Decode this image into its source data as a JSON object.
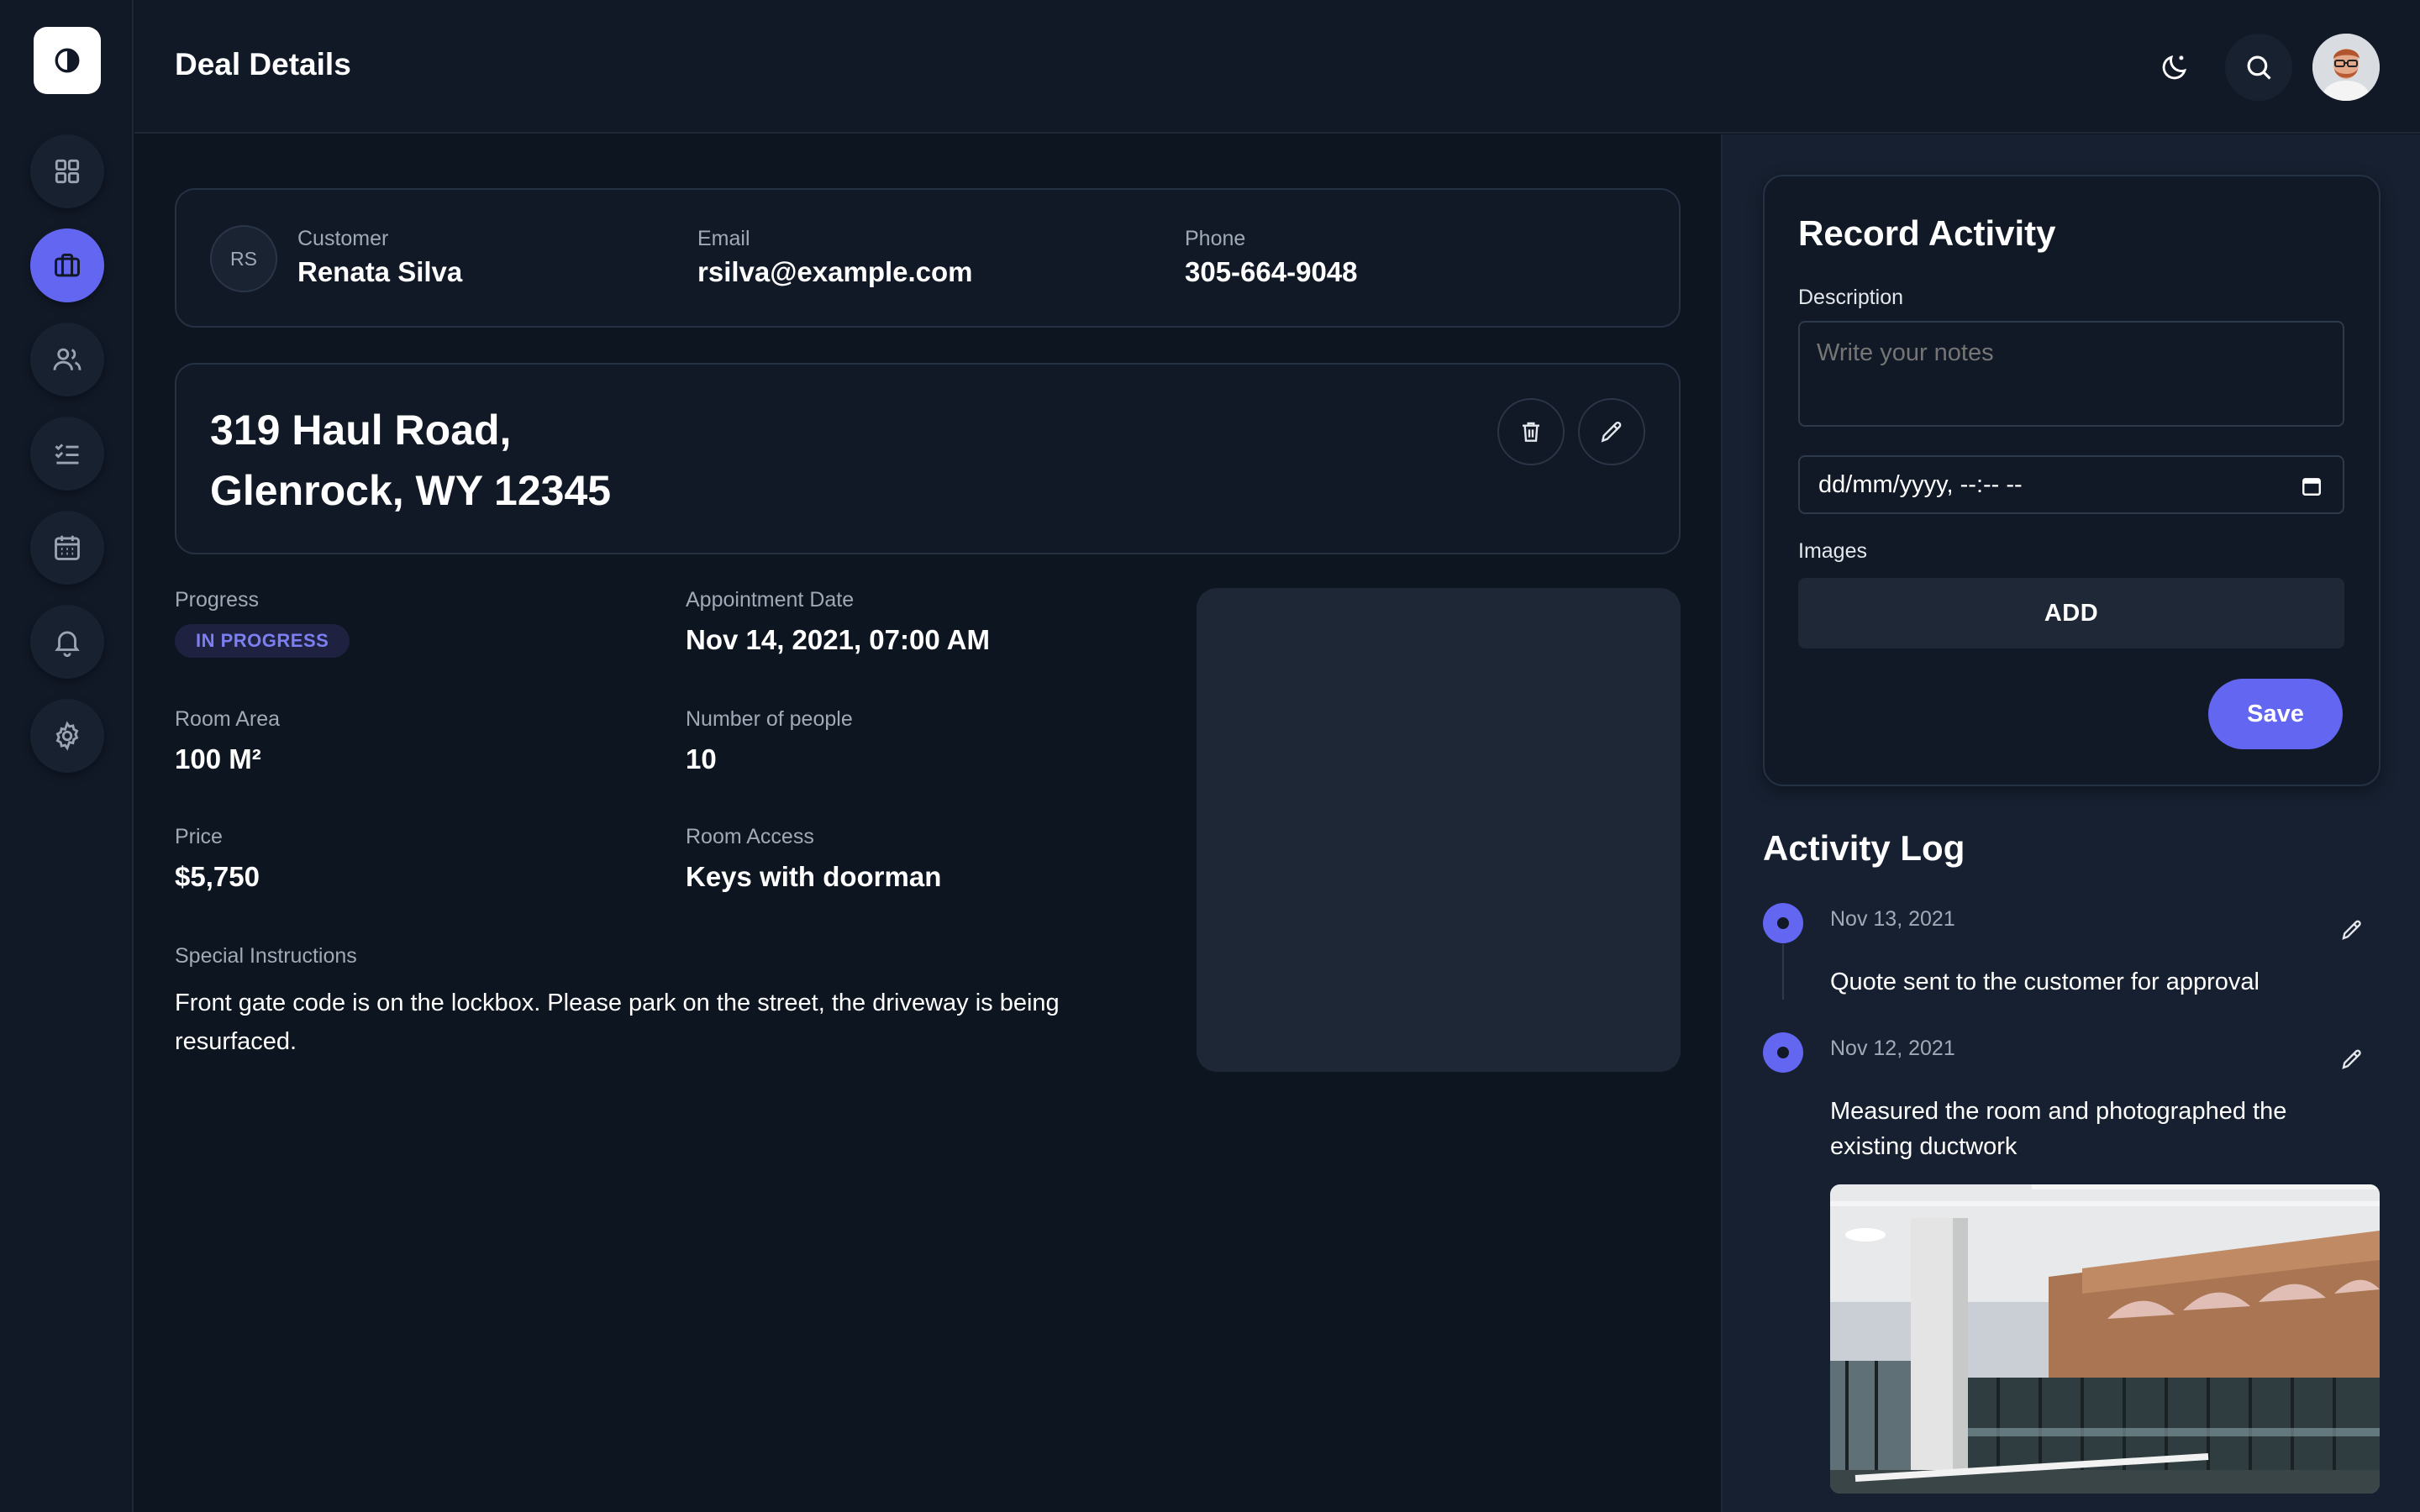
{
  "header": {
    "title": "Deal Details"
  },
  "sidebar": {
    "items": [
      {
        "name": "dashboard",
        "icon": "grid-icon"
      },
      {
        "name": "deals",
        "icon": "briefcase-icon",
        "active": true
      },
      {
        "name": "customers",
        "icon": "users-icon"
      },
      {
        "name": "tasks",
        "icon": "checklist-icon"
      },
      {
        "name": "calendar",
        "icon": "calendar-icon"
      },
      {
        "name": "notifications",
        "icon": "bell-icon"
      },
      {
        "name": "settings",
        "icon": "gear-icon"
      }
    ]
  },
  "customer": {
    "initials": "RS",
    "customer_label": "Customer",
    "name": "Renata Silva",
    "email_label": "Email",
    "email": "rsilva@example.com",
    "phone_label": "Phone",
    "phone": "305-664-9048"
  },
  "deal": {
    "address_line1": "319 Haul Road,",
    "address_line2": "Glenrock, WY 12345",
    "progress_label": "Progress",
    "progress_value": "IN PROGRESS",
    "appointment_label": "Appointment Date",
    "appointment_value": "Nov 14, 2021, 07:00 AM",
    "room_area_label": "Room Area",
    "room_area_value": "100 M²",
    "people_label": "Number of people",
    "people_value": "10",
    "price_label": "Price",
    "price_value": "$5,750",
    "room_access_label": "Room Access",
    "room_access_value": "Keys with doorman",
    "instructions_label": "Special Instructions",
    "instructions_value": "Front gate code is on the lockbox. Please park on the street, the driveway is being resurfaced."
  },
  "record": {
    "title": "Record Activity",
    "description_label": "Description",
    "description_placeholder": "Write your notes",
    "datetime_placeholder": "dd/mm/yyyy, --:-- --",
    "images_label": "Images",
    "add_label": "ADD",
    "save_label": "Save"
  },
  "activity_log": {
    "title": "Activity Log",
    "entries": [
      {
        "date": "Nov 13, 2021",
        "text": "Quote sent to the customer for approval"
      },
      {
        "date": "Nov 12, 2021",
        "text": "Measured the room and photographed the existing ductwork"
      }
    ]
  },
  "colors": {
    "accent": "#6366f1",
    "background": "#0d1520",
    "panel": "#111927"
  }
}
